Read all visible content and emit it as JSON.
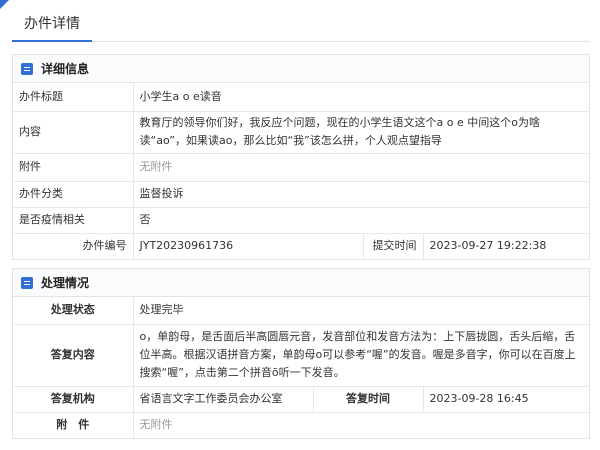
{
  "page": {
    "title": "办件详情"
  },
  "detail": {
    "header": "详细信息",
    "rows": {
      "title": {
        "label": "办件标题",
        "value": "小学生a o e读音"
      },
      "content": {
        "label": "内容",
        "value": "教育厅的领导你们好，我反应个问题，现在的小学生语文这个a o e 中间这个o为啥读“ao”，如果读ao，那么比如“我”该怎么拼，个人观点望指导"
      },
      "attachment": {
        "label": "附件",
        "value": "无附件"
      },
      "category": {
        "label": "办件分类",
        "value": "监督投诉"
      },
      "epidemic": {
        "label": "是否疫情相关",
        "value": "否"
      },
      "number": {
        "label": "办件编号",
        "value": "JYT20230961736"
      },
      "submit_time": {
        "label": "提交时间",
        "value": "2023-09-27 19:22:38"
      }
    }
  },
  "handling": {
    "header": "处理情况",
    "rows": {
      "status": {
        "label": "处理状态",
        "value": "处理完毕"
      },
      "reply": {
        "label": "答复内容",
        "value": "o，单韵母，是舌面后半高圆唇元音，发音部位和发音方法为：上下唇拢圆，舌头后缩，舌位半高。根据汉语拼音方案，单韵母o可以参考“喔”的发音。喔是多音字，你可以在百度上搜索“喔”，点击第二个拼音ō听一下发音。"
      },
      "org": {
        "label": "答复机构",
        "value": "省语言文字工作委员会办公室"
      },
      "reply_time": {
        "label": "答复时间",
        "value": "2023-09-28 16:45"
      },
      "attachment": {
        "label": "附　件",
        "value": "无附件"
      }
    }
  }
}
